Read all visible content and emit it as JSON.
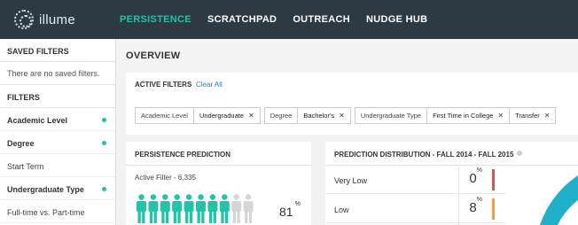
{
  "app": {
    "logo_text": "illume"
  },
  "nav": {
    "items": [
      "PERSISTENCE",
      "SCRATCHPAD",
      "OUTREACH",
      "NUDGE HUB"
    ],
    "active_index": 0
  },
  "sidebar": {
    "saved_title": "SAVED FILTERS",
    "saved_empty": "There are no saved filters.",
    "filters_title": "FILTERS",
    "items": [
      {
        "label": "Academic Level",
        "active": true
      },
      {
        "label": "Degree",
        "active": true
      },
      {
        "label": "Start Term",
        "active": false
      },
      {
        "label": "Undergraduate Type",
        "active": true
      },
      {
        "label": "Full-time vs. Part-time",
        "active": false
      }
    ]
  },
  "main": {
    "title": "OVERVIEW",
    "active_filters": {
      "label": "ACTIVE FILTERS",
      "clear_label": "Clear All",
      "chips": [
        {
          "label": "Academic Level",
          "values": [
            "Undergraduate"
          ]
        },
        {
          "label": "Degree",
          "values": [
            "Bachelor's"
          ]
        },
        {
          "label": "Undergraduate Type",
          "values": [
            "First Time in College",
            "Transfer"
          ]
        }
      ]
    },
    "persistence": {
      "title": "PERSISTENCE PREDICTION",
      "active_filter": "Active Filter - 6,335",
      "percent": "81",
      "percent_unit": "%",
      "icons_total": 10,
      "icons_filled": 8.1
    },
    "distribution": {
      "title": "PREDICTION DISTRIBUTION - FALL 2014 - FALL 2015",
      "rows": [
        {
          "label": "Very Low",
          "value": "0",
          "unit": "%",
          "color": "#d9534f"
        },
        {
          "label": "Low",
          "value": "8",
          "unit": "%",
          "color": "#f0a040"
        }
      ]
    }
  },
  "colors": {
    "teal": "#20c4a8",
    "nav_bg": "#2d3a44",
    "link": "#2f7fd1"
  }
}
